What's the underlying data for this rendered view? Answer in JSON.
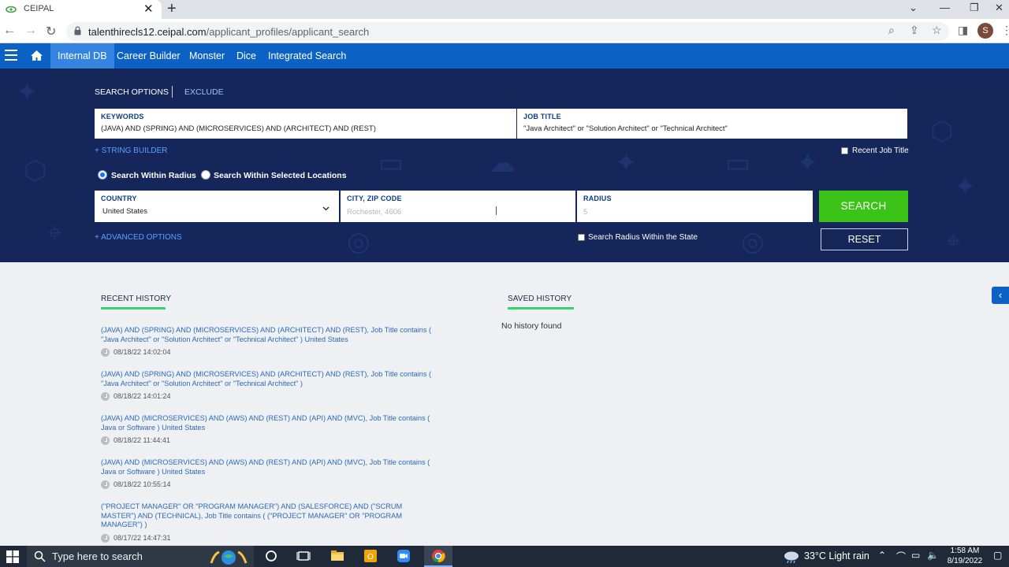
{
  "browser": {
    "tab_title": "CEIPAL",
    "url_domain": "talenthirecls12.ceipal.com",
    "url_path": "/applicant_profiles/applicant_search",
    "profile_initial": "S"
  },
  "nav": {
    "items": [
      "Internal DB",
      "Career Builder",
      "Monster",
      "Dice",
      "Integrated Search"
    ],
    "active": "Internal DB"
  },
  "search": {
    "options_tab": "SEARCH OPTIONS",
    "exclude_tab": "EXCLUDE",
    "keywords_label": "KEYWORDS",
    "keywords_value": "(JAVA) AND (SPRING) AND (MICROSERVICES) AND (ARCHITECT) AND (REST)",
    "jobtitle_label": "JOB TITLE",
    "jobtitle_value": "\"Java Architect\" or \"Solution Architect\" or \"Technical Architect\"",
    "string_builder": "+ STRING BUILDER",
    "recent_job_title": "Recent Job Title",
    "radio_radius": "Search Within Radius",
    "radio_locations": "Search Within Selected Locations",
    "country_label": "COUNTRY",
    "country_value": "United States",
    "city_label": "CITY, ZIP CODE",
    "city_placeholder": "Rochester, 4606",
    "radius_label": "RADIUS",
    "radius_placeholder": "5",
    "search_button": "SEARCH",
    "reset_button": "RESET",
    "advanced_options": "+ ADVANCED OPTIONS",
    "radius_within_state": "Search Radius Within the State"
  },
  "history": {
    "recent_title": "RECENT HISTORY",
    "saved_title": "SAVED HISTORY",
    "no_history": "No history found",
    "items": [
      {
        "query": "(JAVA) AND (SPRING) AND (MICROSERVICES) AND (ARCHITECT) AND (REST), Job Title contains ( \"Java Architect\" or \"Solution Architect\" or \"Technical Architect\" ) United States",
        "time": "08/18/22 14:02:04"
      },
      {
        "query": "(JAVA) AND (SPRING) AND (MICROSERVICES) AND (ARCHITECT) AND (REST), Job Title contains ( \"Java Architect\" or \"Solution Architect\" or \"Technical Architect\" )",
        "time": "08/18/22 14:01:24"
      },
      {
        "query": "(JAVA) AND (MICROSERVICES) AND (AWS) AND (REST) AND (API) AND (MVC), Job Title contains ( Java or Software ) United States",
        "time": "08/18/22 11:44:41"
      },
      {
        "query": "(JAVA) AND (MICROSERVICES) AND (AWS) AND (REST) AND (API) AND (MVC), Job Title contains ( Java or Software ) United States",
        "time": "08/18/22 10:55:14"
      },
      {
        "query": "(\"PROJECT MANAGER\" OR \"PROGRAM MANAGER\") AND (SALESFORCE) AND (\"SCRUM MASTER\") AND (TECHNICAL), Job Title contains ( (\"PROJECT MANAGER\" OR \"PROGRAM MANAGER\") )",
        "time": "08/17/22 14:47:31"
      }
    ]
  },
  "taskbar": {
    "search_placeholder": "Type here to search",
    "weather": "33°C  Light rain",
    "time": "1:58 AM",
    "date": "8/19/2022"
  },
  "colors": {
    "nav_blue": "#0b62c4",
    "panel_navy": "#14265a",
    "search_green": "#3cc318",
    "history_accent": "#32d66c"
  }
}
